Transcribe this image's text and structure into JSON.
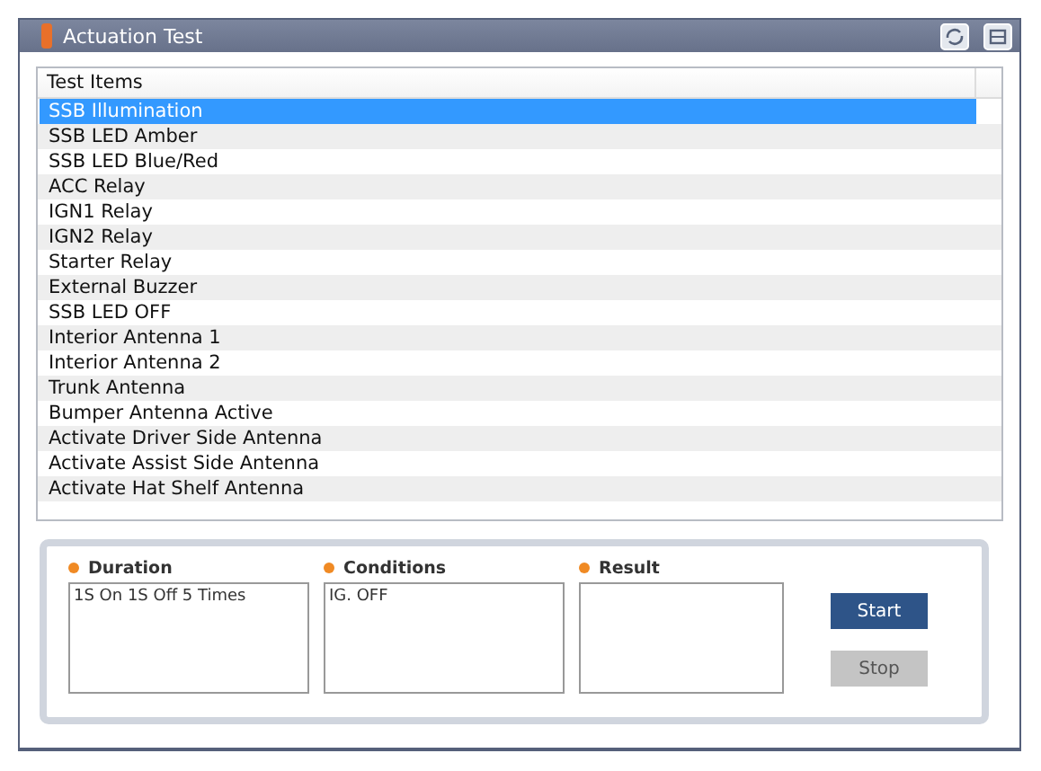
{
  "window": {
    "title": "Actuation Test"
  },
  "table": {
    "columns": [
      "Test Items"
    ],
    "rows": [
      {
        "label": "SSB Illumination",
        "selected": true
      },
      {
        "label": "SSB LED Amber",
        "selected": false
      },
      {
        "label": "SSB LED Blue/Red",
        "selected": false
      },
      {
        "label": "ACC Relay",
        "selected": false
      },
      {
        "label": "IGN1 Relay",
        "selected": false
      },
      {
        "label": "IGN2 Relay",
        "selected": false
      },
      {
        "label": "Starter Relay",
        "selected": false
      },
      {
        "label": "External Buzzer",
        "selected": false
      },
      {
        "label": "SSB LED OFF",
        "selected": false
      },
      {
        "label": "Interior Antenna 1",
        "selected": false
      },
      {
        "label": "Interior Antenna 2",
        "selected": false
      },
      {
        "label": "Trunk Antenna",
        "selected": false
      },
      {
        "label": "Bumper Antenna Active",
        "selected": false
      },
      {
        "label": "Activate Driver Side Antenna",
        "selected": false
      },
      {
        "label": "Activate Assist Side Antenna",
        "selected": false
      },
      {
        "label": "Activate Hat Shelf Antenna",
        "selected": false
      }
    ]
  },
  "fields": [
    {
      "label": "Duration",
      "value": "1S On 1S Off 5 Times"
    },
    {
      "label": "Conditions",
      "value": "IG. OFF"
    },
    {
      "label": "Result"
    }
  ],
  "buttons": [
    {
      "label": "Start",
      "disabled": false
    },
    {
      "label": "Stop",
      "disabled": true
    }
  ]
}
